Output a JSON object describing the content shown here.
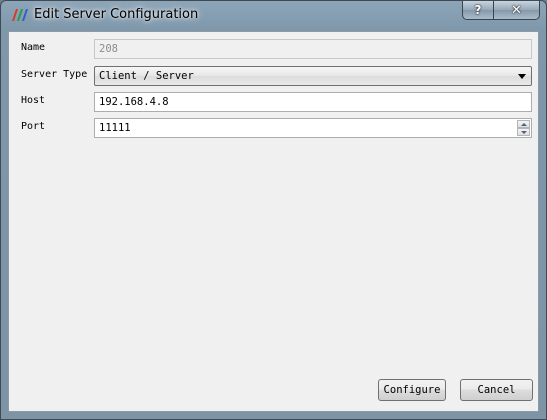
{
  "window": {
    "title": "Edit Server Configuration",
    "icon": "app-logo-icon",
    "help_label": "?",
    "close_label": "✕"
  },
  "form": {
    "name": {
      "label": "Name",
      "value": "208"
    },
    "server_type": {
      "label": "Server Type",
      "value": "Client / Server"
    },
    "host": {
      "label": "Host",
      "value": "192.168.4.8"
    },
    "port": {
      "label": "Port",
      "value": "11111"
    }
  },
  "buttons": {
    "configure": "Configure",
    "cancel": "Cancel"
  }
}
